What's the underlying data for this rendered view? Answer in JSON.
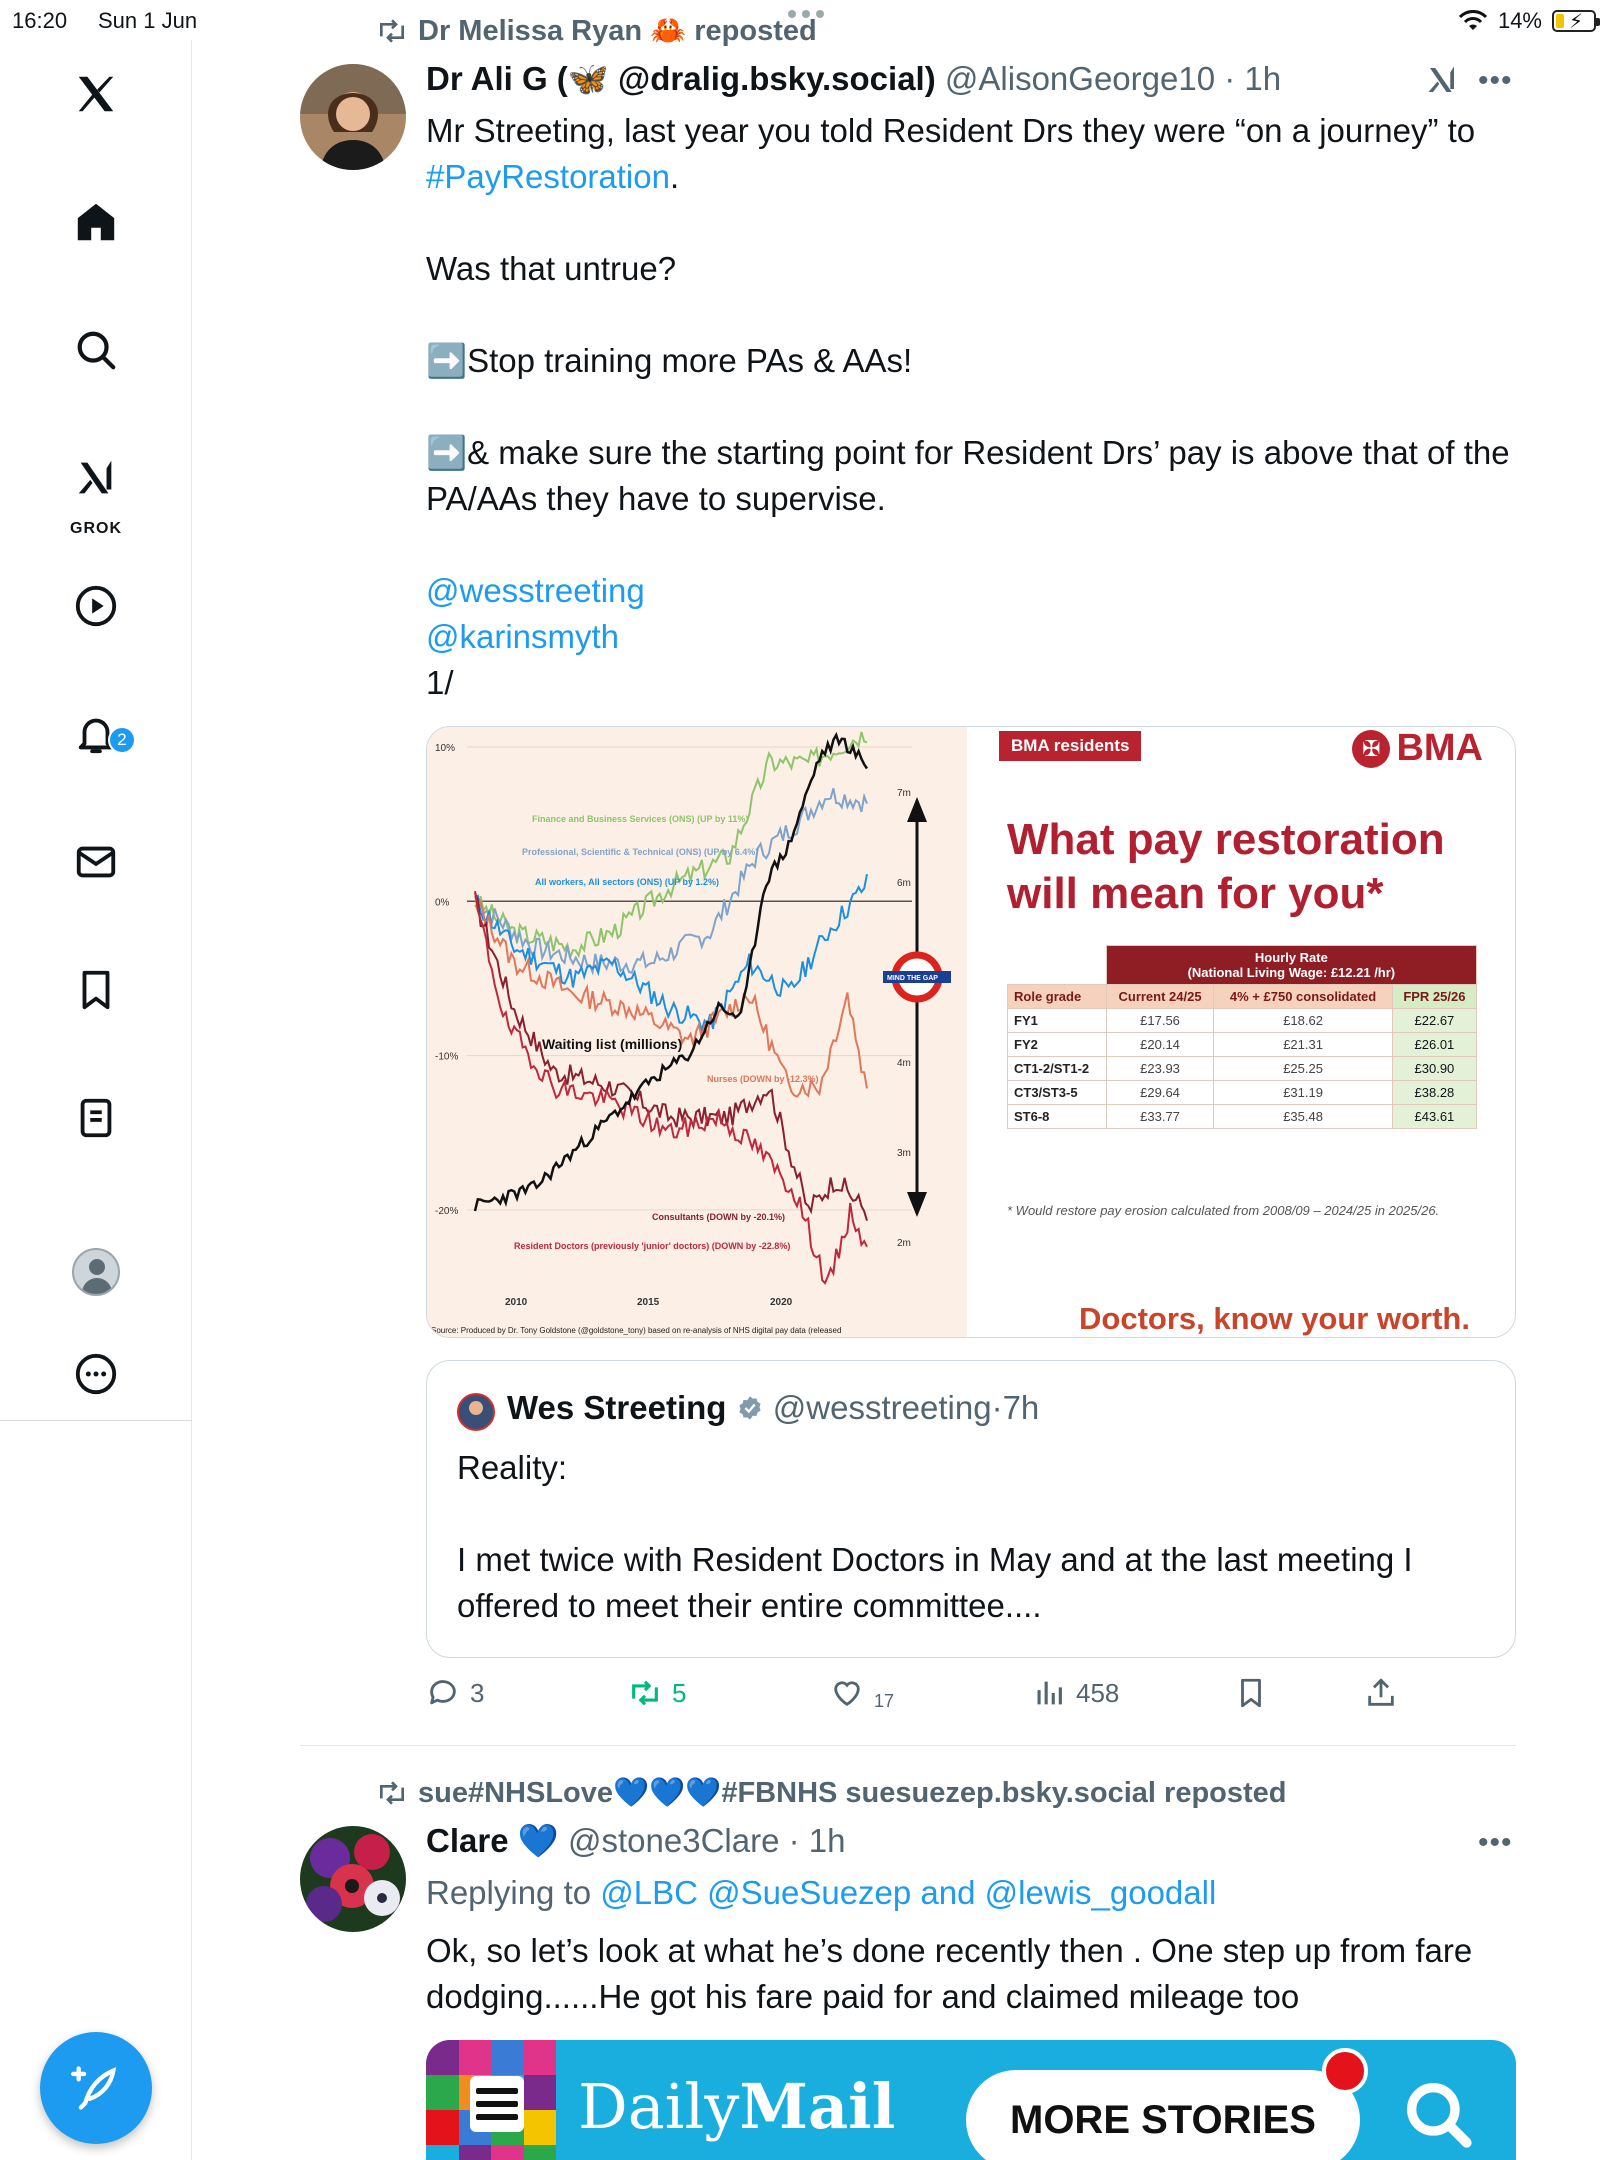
{
  "status": {
    "time": "16:20",
    "date": "Sun 1 Jun",
    "battery": "14%"
  },
  "sidebar": {
    "grok_label": "GROK",
    "notifications_count": "2",
    "items": [
      "x-logo",
      "home",
      "search",
      "grok",
      "video",
      "notifications",
      "messages",
      "bookmarks",
      "lists",
      "profile",
      "more"
    ]
  },
  "post1": {
    "repost_by": "Dr Melissa Ryan 🦀 reposted",
    "name": "Dr Ali G (🦋 @dralig.bsky.social)",
    "handle": "@AlisonGeorge10",
    "sep": "·",
    "time": "1h",
    "text1": "Mr Streeting, last year you told Resident Drs they were “on a journey” to ",
    "hashtag": "#PayRestoration",
    "text1_end": ".",
    "p2": "Was that untrue?",
    "p3": "➡️Stop training more PAs & AAs!",
    "p4": "➡️& make sure the starting point for Resident Drs’ pay is above that of the PA/AAs they have to supervise.",
    "mention1": "@wesstreeting",
    "mention2": "@karinsmyth",
    "thread": "1/"
  },
  "chart_data": {
    "type": "line",
    "x_ticks": [
      "2010",
      "2015",
      "2020"
    ],
    "y_ticks_left": [
      "10%",
      "0%",
      "-10%",
      "-20%"
    ],
    "y_ticks_right": [
      "7m",
      "6m",
      "4m",
      "3m",
      "2m"
    ],
    "ylim_left": [
      -25,
      10
    ],
    "ylim_right": [
      1.5,
      7.5
    ],
    "series": [
      {
        "name": "Finance and Business Services (ONS) (UP by 11%)",
        "color": "#8fc46a"
      },
      {
        "name": "Professional, Scientific & Technical (ONS) (UP by 6.4%)",
        "color": "#7fa3c9"
      },
      {
        "name": "All workers, All sectors (ONS) (UP by 1.2%)",
        "color": "#1d8fe0"
      },
      {
        "name": "Nurses (DOWN by -12.3%)",
        "color": "#e0765a"
      },
      {
        "name": "Consultants (DOWN by -20.1%)",
        "color": "#8a1f2d"
      },
      {
        "name": "Resident Doctors (previously 'junior' doctors) (DOWN by -22.8%)",
        "color": "#c0283b"
      },
      {
        "name": "Waiting list (millions)",
        "color": "#111111"
      }
    ],
    "annotation": "MIND THE GAP",
    "source": "Source: Produced by Dr. Tony Goldstone (@goldstone_tony) based on re-analysis of NHS digital pay data (released"
  },
  "bma": {
    "tag": "BMA residents",
    "logo": "BMA",
    "headline": "What pay restoration will mean for you*",
    "hourly_rate": "Hourly Rate",
    "living_wage": "(National Living Wage: £12.21 /hr)",
    "col_role": "Role grade",
    "col_current": "Current 24/25",
    "col_offer": "4% + £750 consolidated",
    "col_fpr": "FPR 25/26",
    "rows": [
      {
        "role": "FY1",
        "current": "£17.56",
        "offer": "£18.62",
        "fpr": "£22.67"
      },
      {
        "role": "FY2",
        "current": "£20.14",
        "offer": "£21.31",
        "fpr": "£26.01"
      },
      {
        "role": "CT1-2/ST1-2",
        "current": "£23.93",
        "offer": "£25.25",
        "fpr": "£30.90"
      },
      {
        "role": "CT3/ST3-5",
        "current": "£29.64",
        "offer": "£31.19",
        "fpr": "£38.28"
      },
      {
        "role": "ST6-8",
        "current": "£33.77",
        "offer": "£35.48",
        "fpr": "£43.61"
      }
    ],
    "footnote": "* Would restore pay erosion calculated from 2008/09 – 2024/25 in 2025/26.",
    "footer": "Doctors, know your worth."
  },
  "quote": {
    "name": "Wes Streeting",
    "handle": "@wesstreeting",
    "sep": "·",
    "time": "7h",
    "text": "Reality:\n\nI met twice with Resident Doctors in May and at the last meeting I offered to meet their entire committee...."
  },
  "actions": {
    "replies": "3",
    "reposts": "5",
    "likes": "17",
    "views": "458"
  },
  "post2": {
    "repost_by": "sue#NHSLove💙💙💙#FBNHS suesuezep.bsky.social reposted",
    "name": "Clare 💙",
    "handle": "@stone3Clare",
    "sep": "·",
    "time": "1h",
    "replying_prefix": "Replying to ",
    "replying_to": "@LBC @SueSuezep and @lewis_goodall",
    "text": "Ok, so let’s look at what he’s done recently then . One step up from fare dodging......He got his fare paid for and claimed mileage too"
  },
  "ad": {
    "logo_a": "Daily",
    "logo_b": "Mail",
    "button": "MORE STORIES"
  }
}
